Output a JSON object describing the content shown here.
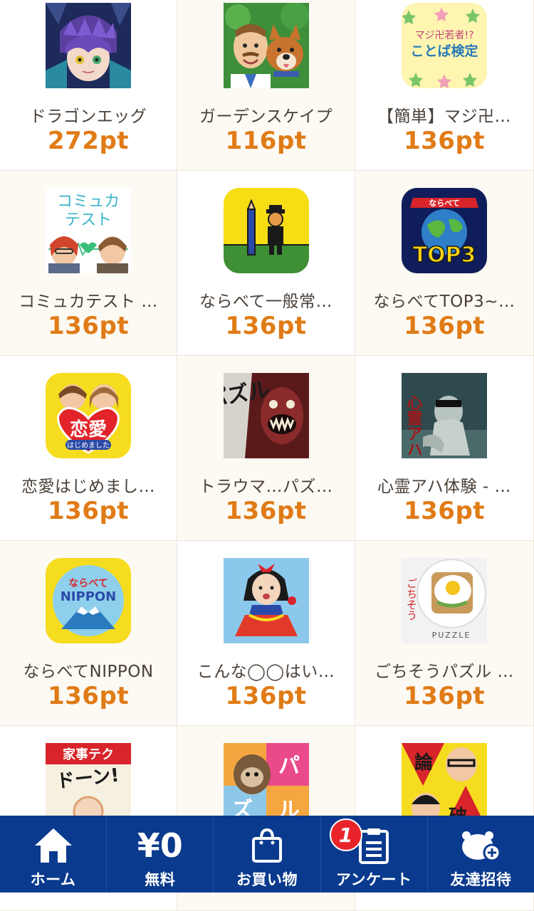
{
  "apps": [
    {
      "name": "ドラゴンエッグ",
      "points": "272pt",
      "icon": "dragon-egg-icon"
    },
    {
      "name": "ガーデンスケイプ",
      "points": "116pt",
      "icon": "gardenscapes-icon"
    },
    {
      "name": "【簡単】マジ卍…",
      "points": "136pt",
      "icon": "maji-kotoba-icon",
      "icon_text": [
        "マジ卍若者!?",
        "ことば検定"
      ]
    },
    {
      "name": "コミュカテスト …",
      "points": "136pt",
      "icon": "comm-test-icon",
      "icon_text": [
        "コミュカ",
        "テスト"
      ]
    },
    {
      "name": "ならべて一般常…",
      "points": "136pt",
      "icon": "narabete-general-icon"
    },
    {
      "name": "ならべてTOP3~…",
      "points": "136pt",
      "icon": "narabete-top3-icon",
      "icon_text": [
        "ならべて",
        "TOP3"
      ]
    },
    {
      "name": "恋愛はじめまし…",
      "points": "136pt",
      "icon": "renai-icon",
      "icon_text": [
        "恋愛",
        "はじめました"
      ]
    },
    {
      "name": "トラウマ…パズ…",
      "points": "136pt",
      "icon": "trauma-puzzle-icon",
      "icon_text": [
        "パズル"
      ]
    },
    {
      "name": "心霊アハ体験 - …",
      "points": "136pt",
      "icon": "shinrei-aha-icon",
      "icon_text": [
        "心霊アハ"
      ]
    },
    {
      "name": "ならべてNIPPON",
      "points": "136pt",
      "icon": "narabete-nippon-icon",
      "icon_text": [
        "ならべて",
        "NIPPON"
      ]
    },
    {
      "name": "こんな◯◯はい…",
      "points": "136pt",
      "icon": "konna-icon"
    },
    {
      "name": "ごちそうパズル …",
      "points": "136pt",
      "icon": "gochisou-puzzle-icon",
      "icon_text": [
        "ごちそう",
        "PUZZLE"
      ]
    },
    {
      "name": "",
      "points": "",
      "icon": "kaji-tech-icon",
      "icon_text": [
        "家事テク",
        "ドーン!"
      ]
    },
    {
      "name": "",
      "points": "",
      "icon": "puzzle-sloth-icon",
      "icon_text": [
        "パ",
        "ズ",
        "ル"
      ]
    },
    {
      "name": "",
      "points": "",
      "icon": "ronpa-icon",
      "icon_text": [
        "論",
        "破"
      ]
    }
  ],
  "nav": {
    "home": "ホーム",
    "free_amount": "¥0",
    "free": "無料",
    "shopping": "お買い物",
    "survey": "アンケート",
    "survey_badge": "1",
    "invite": "友達招待"
  },
  "colors": {
    "points": "#e07b16",
    "nav_bg": "#0a3a8e",
    "badge": "#e8242a",
    "alt_cell": "#fdf9f3"
  }
}
